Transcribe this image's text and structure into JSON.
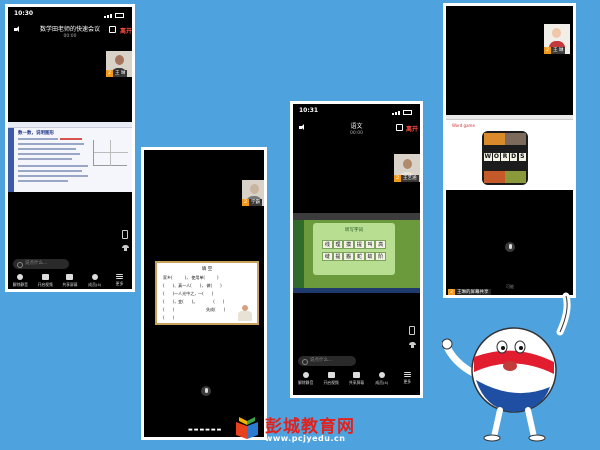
{
  "phone1": {
    "time": "10:30",
    "meeting_title": "数学田老师的快速会议",
    "meeting_sub": "00:00",
    "leave": "离开",
    "participant_badge": "2",
    "participant_name": "王 琳",
    "slide_heading": "数一数，说明图形",
    "chat_placeholder": "说点什么...",
    "toolbar": [
      {
        "label": "解除静音",
        "icon": "mic-icon"
      },
      {
        "label": "开启视频",
        "icon": "camera-icon"
      },
      {
        "label": "共享屏幕",
        "icon": "share-screen-icon"
      },
      {
        "label": "成员(4)",
        "icon": "members-icon"
      },
      {
        "label": "更多",
        "icon": "more-icon"
      }
    ]
  },
  "phone2": {
    "participant_badge": "2",
    "participant_name": "学霸",
    "slide_heading": "填 空",
    "slide_lines": [
      "家乡(　　　)，  使用单(　　　)",
      "(　　)、真一人(　　)，  做(　　)",
      "(　　)一人光中之，一(　　)",
      "(　　)，变(　　)。　　　　(　　)",
      "(　　)　　　　　　　　失成(　　)",
      "(　　)"
    ],
    "home_indicator": "▬▬▬▬▬▬"
  },
  "phone3": {
    "time": "10:31",
    "meeting_title": "语文",
    "meeting_sub": "00:00",
    "leave": "离开",
    "participant_badge": "2",
    "participant_name": "王艺涵",
    "card_title": "听写字词",
    "chars_row1": [
      "线",
      "理",
      "摸",
      "提",
      "叫",
      "高"
    ],
    "chars_row2": [
      "缝",
      "提",
      "搬",
      "蛇",
      "蚁",
      "阶"
    ],
    "chat_placeholder": "说点什么...",
    "toolbar": [
      {
        "label": "解除静音",
        "icon": "mic-icon"
      },
      {
        "label": "开启视频",
        "icon": "camera-icon"
      },
      {
        "label": "共享屏幕",
        "icon": "share-screen-icon"
      },
      {
        "label": "成员(4)",
        "icon": "members-icon"
      },
      {
        "label": "更多",
        "icon": "more-icon"
      }
    ]
  },
  "phone4": {
    "participant_badge": "2",
    "participant_name": "王 琳",
    "app_label": "Word game",
    "word_letters": [
      "W",
      "O",
      "R",
      "D",
      "S"
    ],
    "bottom_badge": "2",
    "bottom_label": "王琳的屏幕共享",
    "tip": "可能"
  },
  "colors": {
    "background": "#4ea3de",
    "leave_red": "#ff4d3d",
    "badge_orange": "#f39a1d",
    "watermark_red": "#e4201b"
  },
  "watermark": {
    "title": "彭城教育网",
    "url": "www.pcjyedu.cn"
  }
}
